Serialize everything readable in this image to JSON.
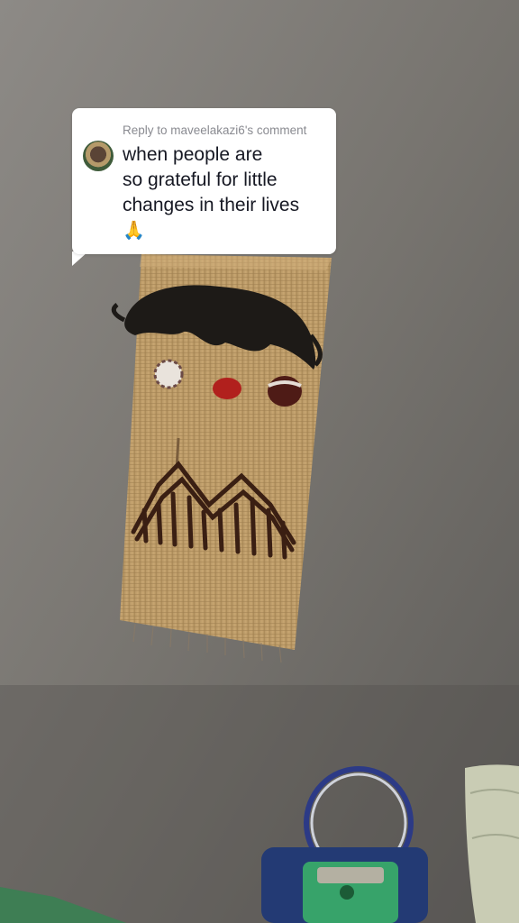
{
  "reply": {
    "header": "Reply to maveelakazi6's comment",
    "lines": [
      "when people are",
      "so grateful for little",
      "changes in their lives"
    ],
    "emoji": "🙏"
  }
}
